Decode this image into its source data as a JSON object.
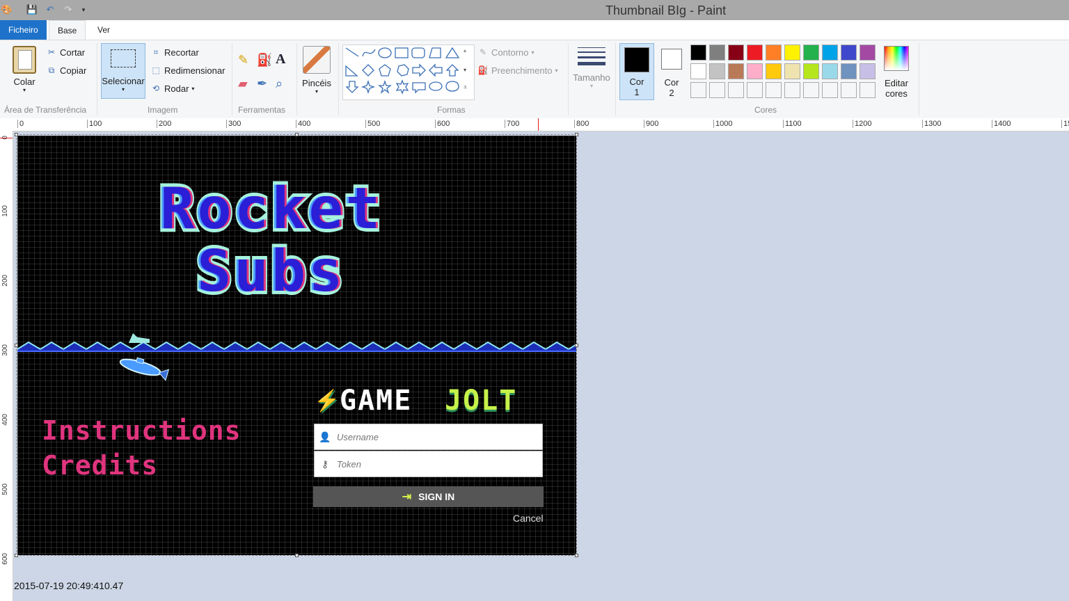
{
  "window": {
    "title": "Thumbnail BIg - Paint"
  },
  "tabs": {
    "file": "Ficheiro",
    "home": "Base",
    "view": "Ver"
  },
  "clipboard": {
    "paste": "Colar",
    "cut": "Cortar",
    "copy": "Copiar",
    "label": "Área de Transferência"
  },
  "image": {
    "select": "Selecionar",
    "crop": "Recortar",
    "resize": "Redimensionar",
    "rotate": "Rodar",
    "label": "Imagem"
  },
  "tools": {
    "label": "Ferramentas"
  },
  "brushes": {
    "label": "Pincéis"
  },
  "shapes": {
    "outline": "Contorno",
    "fill": "Preenchimento",
    "label": "Formas"
  },
  "size": {
    "label": "Tamanho"
  },
  "colors": {
    "color1_label": "Cor",
    "color1_num": "1",
    "color2_label": "Cor",
    "color2_num": "2",
    "edit_label": "Editar",
    "edit_label2": "cores",
    "label": "Cores",
    "color1": "#000000",
    "color2": "#ffffff",
    "palette_row1": [
      "#000000",
      "#7f7f7f",
      "#880015",
      "#ed1c24",
      "#ff7f27",
      "#fff200",
      "#22b14c",
      "#00a2e8",
      "#3f48cc",
      "#a349a4"
    ],
    "palette_row2": [
      "#ffffff",
      "#c3c3c3",
      "#b97a57",
      "#ffaec9",
      "#ffc90e",
      "#efe4b0",
      "#b5e61d",
      "#99d9ea",
      "#7092be",
      "#c8bfe7"
    ],
    "palette_row3": [
      "#f5f6f7",
      "#f5f6f7",
      "#f5f6f7",
      "#f5f6f7",
      "#f5f6f7",
      "#f5f6f7",
      "#f5f6f7",
      "#f5f6f7",
      "#f5f6f7",
      "#f5f6f7"
    ]
  },
  "ruler": {
    "h": [
      "0",
      "100",
      "200",
      "300",
      "400",
      "500",
      "600",
      "700",
      "800",
      "900",
      "1000",
      "1100",
      "1200",
      "1300",
      "1400",
      "15"
    ],
    "v": [
      "0",
      "100",
      "200",
      "300",
      "400",
      "500",
      "600"
    ]
  },
  "game": {
    "title_line1": "Rocket",
    "title_line2": "Subs",
    "menu_instructions": "Instructions",
    "menu_credits": "Credits",
    "brand_game": "GAME",
    "brand_jolt": "JOLT",
    "username_placeholder": "Username",
    "token_placeholder": "Token",
    "signin": "SIGN IN",
    "cancel": "Cancel"
  },
  "status": {
    "timestamp": "2015-07-19 20:49:410.47"
  }
}
